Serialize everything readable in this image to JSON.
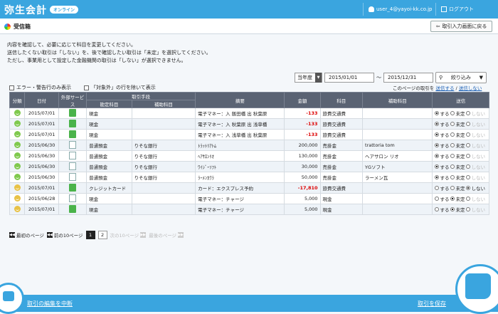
{
  "app": {
    "logo": "弥生会計",
    "status": "オンライン",
    "user": "user_4@yayoi-kk.co.jp",
    "logout": "ログアウト"
  },
  "header": {
    "title": "受信箱",
    "back_button": "取引入力画面に戻る"
  },
  "info_lines": [
    "内容を確認して、必要に応じて科目を変更してください。",
    "送信したくない取引は「しない」を、後で確認したい取引は「未定」を選択してください。",
    "ただし、事業用として設定した金融機関の取引は「しない」が選択できません。"
  ],
  "filters": {
    "period": "当年度",
    "date_from": "2015/01/01",
    "tilde": "～",
    "date_to": "2015/12/31",
    "narrow": "絞り込み"
  },
  "checkboxes": {
    "errors_only": "エラー・警告行のみ表示",
    "exclude_nontarget": "「対象外」の行を除いて表示"
  },
  "page_all": {
    "prefix": "このページの取引を",
    "send": "送信する",
    "slash": "/",
    "not_send": "送信しない"
  },
  "columns": {
    "category": "分類",
    "date": "日付",
    "service": "外部サービス",
    "method": "取引手段",
    "fixed_account": "勘定科目",
    "sub_account": "補助科目",
    "summary": "摘要",
    "amount": "金額",
    "account": "科目",
    "aux": "補助科目",
    "send": "送信"
  },
  "radio_labels": {
    "yes": "する",
    "undecided": "未定",
    "no": "しない"
  },
  "rows": [
    {
      "date": "2015/07/01",
      "method": "現金",
      "bank": "",
      "summary": "電子マネー：入 飯田橋 出 秋葉原",
      "amount": "-133",
      "account": "旅費交通費",
      "aux": ""
    },
    {
      "date": "2015/07/01",
      "method": "現金",
      "bank": "",
      "summary": "電子マネー：入 秋葉原 出 浅草橋",
      "amount": "-133",
      "account": "旅費交通費",
      "aux": ""
    },
    {
      "date": "2015/07/01",
      "method": "現金",
      "bank": "",
      "summary": "電子マネー：入 浅草橋 出 秋葉原",
      "amount": "-133",
      "account": "旅費交通費",
      "aux": ""
    },
    {
      "date": "2015/06/30",
      "method": "普通預金",
      "bank": "りそな銀行",
      "summary": "ﾄﾗｯﾄﾘｱﾄﾑ",
      "amount": "200,000",
      "account": "売掛金",
      "aux": "trattoria tom"
    },
    {
      "date": "2015/06/30",
      "method": "普通預金",
      "bank": "りそな銀行",
      "summary": "ﾍｱｻﾛﾝﾘｵ",
      "amount": "130,000",
      "account": "売掛金",
      "aux": "ヘアサロン リオ"
    },
    {
      "date": "2015/06/30",
      "method": "普通預金",
      "bank": "りそな銀行",
      "summary": "ﾜｲｼﾞｰｿﾌﾄ",
      "amount": "30,000",
      "account": "売掛金",
      "aux": "YGソフト"
    },
    {
      "date": "2015/06/30",
      "method": "普通預金",
      "bank": "りそな銀行",
      "summary": "ﾗｰﾒﾝｶﾜﾗ",
      "amount": "50,000",
      "account": "売掛金",
      "aux": "ラーメン瓦"
    },
    {
      "date": "2015/07/01",
      "method": "クレジットカード",
      "bank": "",
      "summary": "カード：エクスプレス予約",
      "amount": "-17,810",
      "account": "旅費交通費",
      "aux": ""
    },
    {
      "date": "2015/06/28",
      "method": "現金",
      "bank": "",
      "summary": "電子マネー：チャージ",
      "amount": "5,000",
      "account": "現金",
      "aux": ""
    },
    {
      "date": "2015/07/01",
      "method": "現金",
      "bank": "",
      "summary": "電子マネー：チャージ",
      "amount": "5,000",
      "account": "現金",
      "aux": ""
    }
  ],
  "pager": {
    "first": "最初のページ",
    "prev": "前の10ページ",
    "p1": "1",
    "p2": "2",
    "next": "次の10ページ",
    "last": "最後のページ"
  },
  "bottom": {
    "cancel": "取引の編集を中断",
    "save": "取引を保存"
  }
}
